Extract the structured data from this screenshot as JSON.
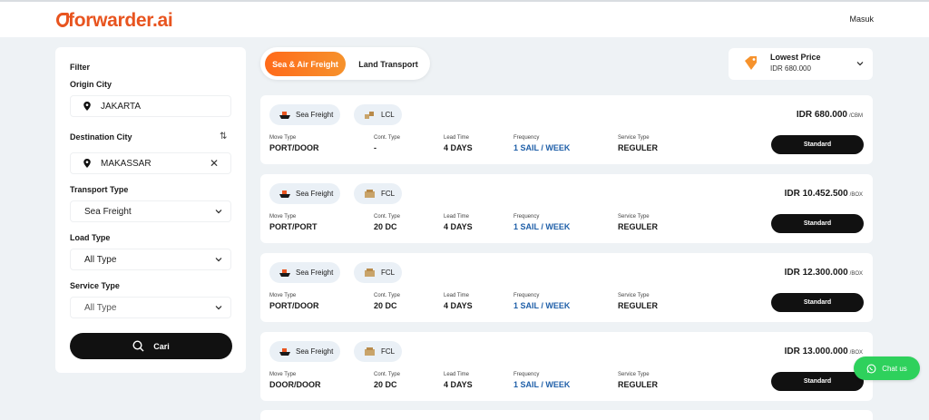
{
  "header": {
    "logo": "forwarder.ai",
    "login": "Masuk"
  },
  "filter": {
    "title": "Filter",
    "origin_label": "Origin City",
    "origin_value": "JAKARTA",
    "destination_label": "Destination City",
    "destination_value": "MAKASSAR",
    "transport_label": "Transport Type",
    "transport_value": "Sea Freight",
    "load_label": "Load Type",
    "load_value": "All Type",
    "service_label": "Service Type",
    "service_value": "All Type",
    "search_button": "Cari"
  },
  "tabs": {
    "active": "Sea & Air Freight",
    "inactive": "Land Transport"
  },
  "sort": {
    "label": "Lowest Price",
    "value": "IDR 680.000"
  },
  "column_labels": {
    "move": "Move Type",
    "cont": "Cont. Type",
    "lead": "Lead Time",
    "freq": "Frequency",
    "service": "Service Type"
  },
  "results": [
    {
      "mode": "Sea Freight",
      "load": "LCL",
      "price": "IDR 680.000",
      "unit": "/CBM",
      "move": "PORT/DOOR",
      "cont": "-",
      "lead": "4 DAYS",
      "freq": "1 SAIL / WEEK",
      "service": "REGULER",
      "button": "Standard"
    },
    {
      "mode": "Sea Freight",
      "load": "FCL",
      "price": "IDR 10.452.500",
      "unit": "/BOX",
      "move": "PORT/PORT",
      "cont": "20 DC",
      "lead": "4 DAYS",
      "freq": "1 SAIL / WEEK",
      "service": "REGULER",
      "button": "Standard"
    },
    {
      "mode": "Sea Freight",
      "load": "FCL",
      "price": "IDR 12.300.000",
      "unit": "/BOX",
      "move": "PORT/DOOR",
      "cont": "20 DC",
      "lead": "4 DAYS",
      "freq": "1 SAIL / WEEK",
      "service": "REGULER",
      "button": "Standard"
    },
    {
      "mode": "Sea Freight",
      "load": "FCL",
      "price": "IDR 13.000.000",
      "unit": "/BOX",
      "move": "DOOR/DOOR",
      "cont": "20 DC",
      "lead": "4 DAYS",
      "freq": "1 SAIL / WEEK",
      "service": "REGULER",
      "button": "Standard"
    }
  ],
  "chat": {
    "label": "Chat us"
  },
  "colors": {
    "brand": "#e8541f",
    "accent_gradient_start": "#ff6a1a",
    "link_blue": "#1f5fa8",
    "chat_green": "#2ed15c"
  },
  "icons": [
    "location-pin-icon",
    "swap-icon",
    "close-icon",
    "chevron-down-icon",
    "search-icon",
    "price-tag-icon",
    "ship-icon",
    "box-icon",
    "whatsapp-icon"
  ]
}
